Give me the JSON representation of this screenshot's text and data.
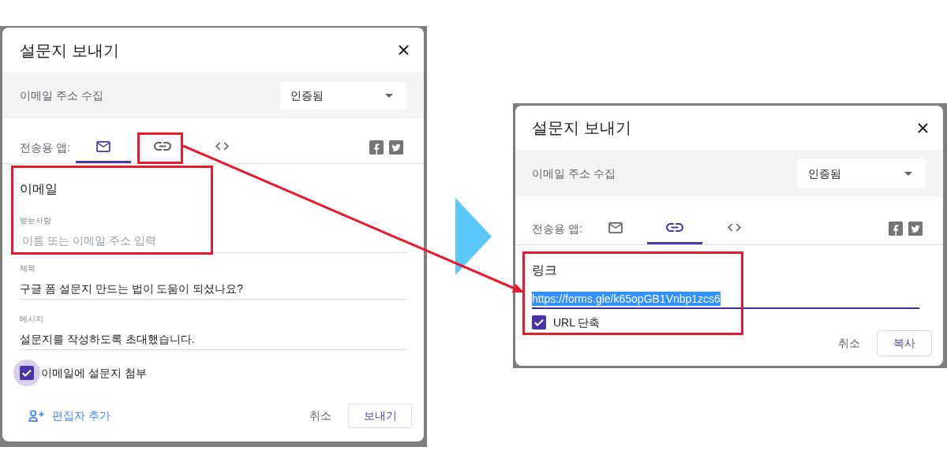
{
  "screens": [
    {
      "title": "설문지 보내기",
      "collect_email": {
        "label": "이메일 주소 수집",
        "value": "인증됨"
      },
      "send_via": {
        "label": "전송용 앱:",
        "tabs": [
          {
            "kind": "email",
            "selected": true
          },
          {
            "kind": "link",
            "selected": false
          },
          {
            "kind": "embed",
            "selected": false
          }
        ]
      },
      "panel": {
        "kind": "email",
        "heading": "이메일",
        "fields": [
          {
            "label": "받는사람",
            "placeholder": "이름 또는 이메일 주소 입력"
          },
          {
            "label": "제목",
            "value": "구글 폼 설문지 만드는 법이 도움이 되셨나요?"
          },
          {
            "label": "메시지",
            "value": "설문지를 작성하도록 초대했습니다."
          }
        ],
        "checkbox": {
          "label": "이메일에 설문지 첨부",
          "checked": true,
          "focused": true
        }
      },
      "footer": {
        "link": "편집자 추가",
        "cancel": "취소",
        "primary": "보내기"
      }
    },
    {
      "title": "설문지 보내기",
      "collect_email": {
        "label": "이메일 주소 수집",
        "value": "인증됨"
      },
      "send_via": {
        "label": "전송용 앱:",
        "tabs": [
          {
            "kind": "email",
            "selected": false
          },
          {
            "kind": "link",
            "selected": true
          },
          {
            "kind": "embed",
            "selected": false
          }
        ]
      },
      "panel": {
        "kind": "link",
        "heading": "링크",
        "url": {
          "value": "https://forms.gle/k65opGB1Vnbp1zcs6",
          "selected": true
        },
        "checkbox": {
          "label": "URL 단축",
          "checked": true,
          "focused": false
        }
      },
      "footer": {
        "cancel": "취소",
        "primary": "복사"
      }
    }
  ]
}
